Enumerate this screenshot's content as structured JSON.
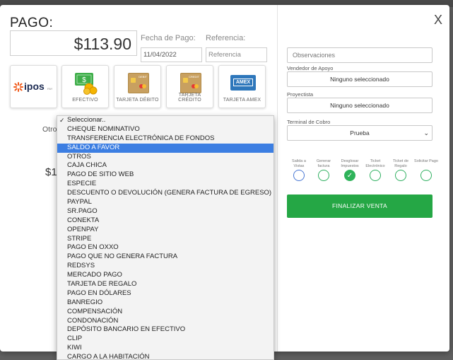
{
  "modal": {
    "title": "PAGO:",
    "close_label": "X"
  },
  "payment": {
    "amount": "$113.90",
    "date_label": "Fecha de Pago:",
    "date_value": "11/04/2022",
    "reference_label": "Referencia:",
    "reference_placeholder": "Referencia"
  },
  "methods": [
    {
      "label": "",
      "icon": "ipos-logo"
    },
    {
      "label": "EFECTIVO",
      "icon": "cash-icon"
    },
    {
      "label": "TARJETA DÉBITO",
      "icon": "debit-card-icon"
    },
    {
      "label": "TARJETA CRÉDITO",
      "icon": "credit-card-icon"
    },
    {
      "label": "TARJETA AMEX",
      "icon": "amex-card-icon"
    }
  ],
  "ipos_logo_text": "ipos",
  "ipos_logo_sub": "PAY",
  "debit_tag": "DEBIT",
  "credit_tag": "CREDIT",
  "amex_tag": "AMEX",
  "otro": {
    "label": "Otro",
    "partial_amount": "$1"
  },
  "dropdown": {
    "selected_index": 3,
    "checked_index": 0,
    "options": [
      "Seleccionar..",
      "CHEQUE NOMINATIVO",
      "TRANSFERENCIA ELECTRÓNICA DE FONDOS",
      "SALDO A FAVOR",
      "OTROS",
      "CAJA CHICA",
      "PAGO DE SITIO WEB",
      "ESPECIE",
      "DESCUENTO O DEVOLUCIÓN (GENERA FACTURA DE EGRESO)",
      "PAYPAL",
      "SR.PAGO",
      "CONEKTA",
      "OPENPAY",
      "STRIPE",
      "PAGO EN OXXO",
      "PAGO QUE NO GENERA FACTURA",
      "REDSYS",
      "MERCADO PAGO",
      "TARJETA DE REGALO",
      "PAGO EN DÓLARES",
      "BANREGIO",
      "COMPENSACIÓN",
      "CONDONACIÓN",
      "DEPÓSITO BANCARIO EN EFECTIVO",
      "CLIP",
      "KIWI",
      "CARGO A LA HABITACIÓN"
    ]
  },
  "right": {
    "observations_placeholder": "Observaciones",
    "vendor_label": "Vendedor de Apoyo",
    "vendor_value": "Ninguno seleccionado",
    "projectist_label": "Proyectista",
    "projectist_value": "Ninguno seleccionado",
    "terminal_label": "Terminal de Cobro",
    "terminal_value": "Prueba",
    "toggles": [
      {
        "label": "Salida a Vistas",
        "state": "off"
      },
      {
        "label": "Generar factura",
        "state": "off"
      },
      {
        "label": "Desglosar Impuestos",
        "state": "on"
      },
      {
        "label": "Ticket Electrónico",
        "state": "off"
      },
      {
        "label": "Ticket de Regalo",
        "state": "off"
      },
      {
        "label": "Solicitar Pago",
        "state": "off"
      }
    ],
    "finalize_label": "FINALIZAR VENTA"
  },
  "colors": {
    "accent_green": "#25a745",
    "selection_blue": "#3c7ee2",
    "ipos_orange": "#f05a1a"
  }
}
